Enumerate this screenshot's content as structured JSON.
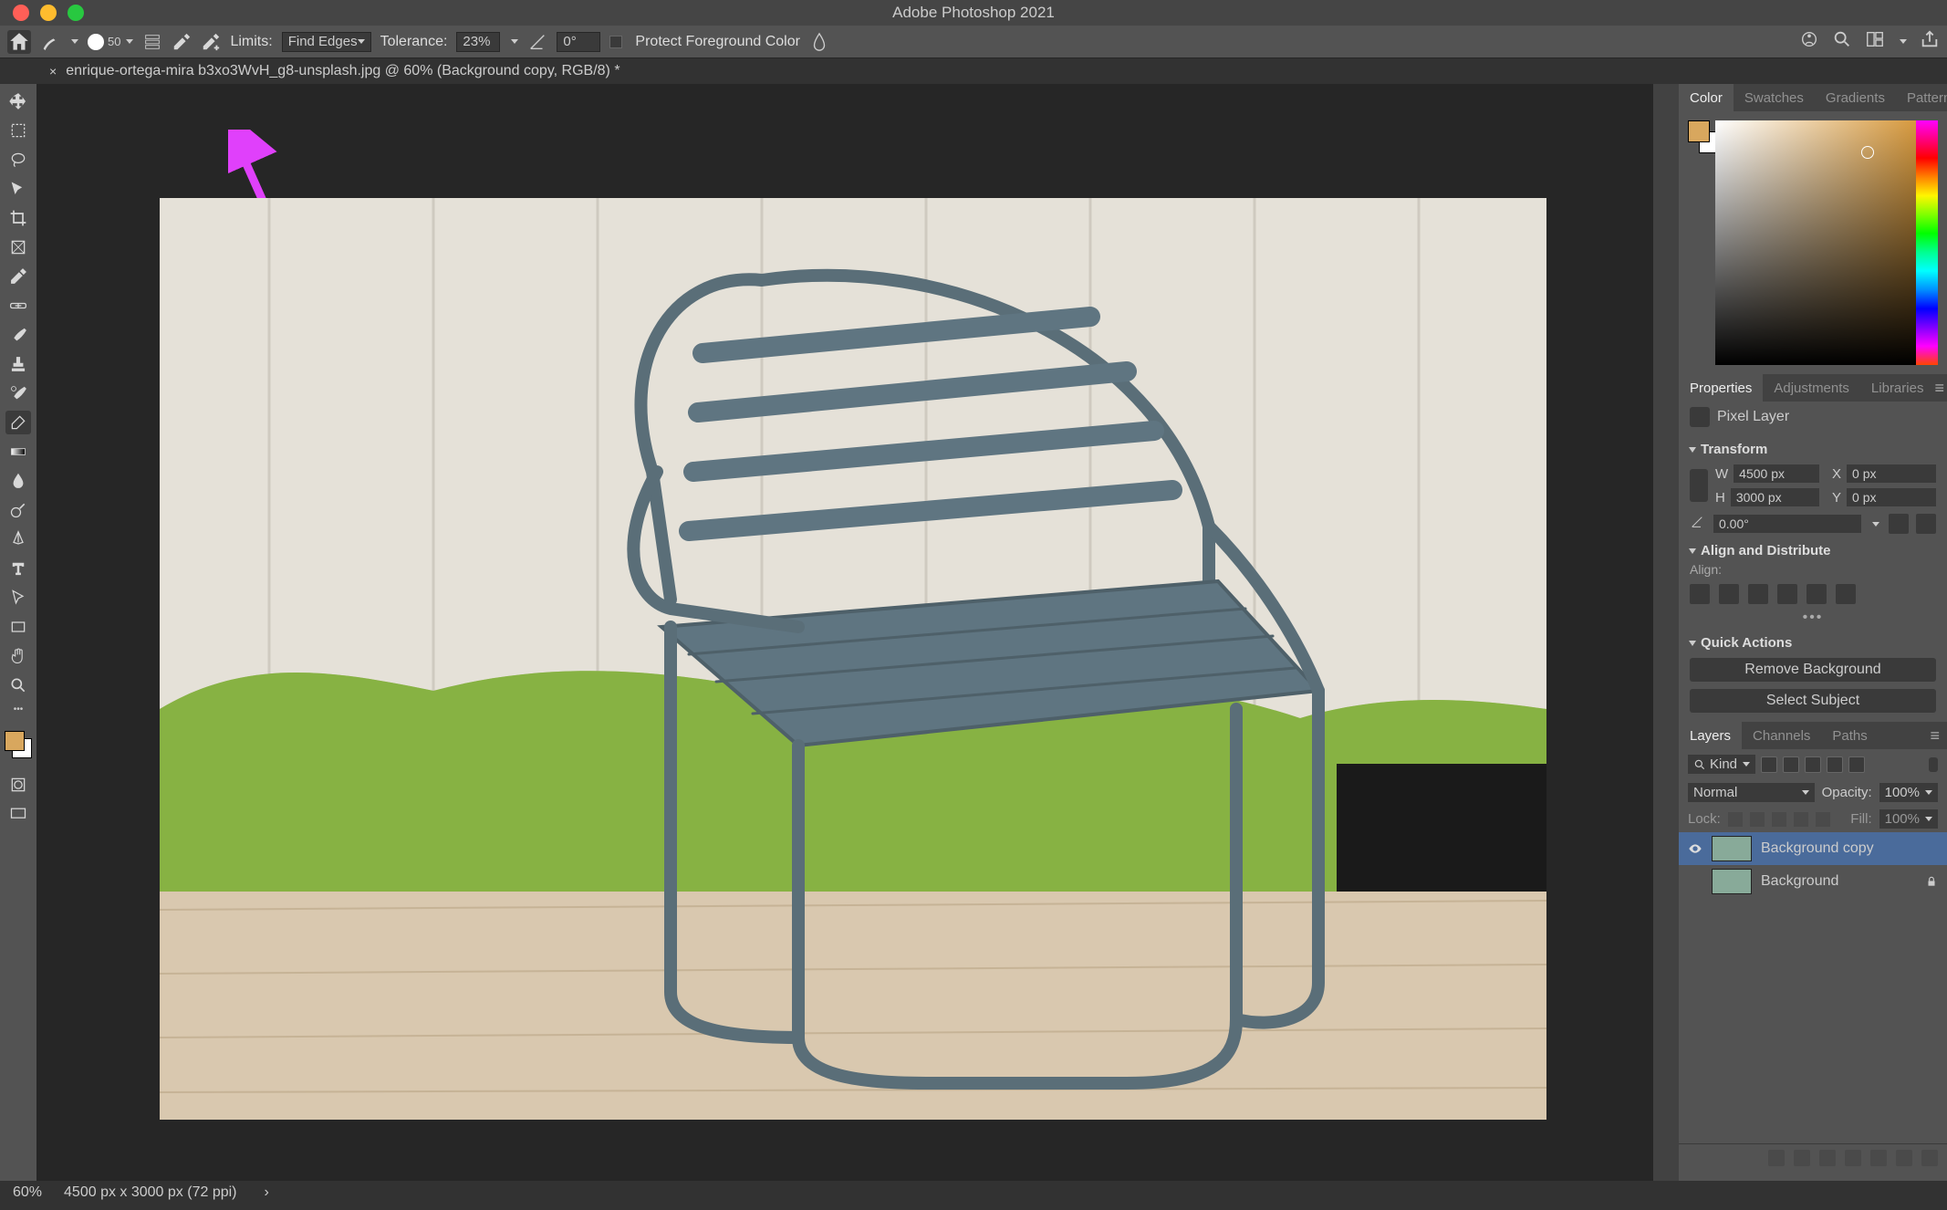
{
  "titlebar": {
    "title": "Adobe Photoshop 2021"
  },
  "optbar": {
    "brush_size": "50",
    "limits_label": "Limits:",
    "limits_value": "Find Edges",
    "tolerance_label": "Tolerance:",
    "tolerance_value": "23%",
    "angle_value": "0°",
    "protect_label": "Protect Foreground Color"
  },
  "doctab": {
    "tabname": "enrique-ortega-mira         b3xo3WvH_g8-unsplash.jpg @ 60% (Background copy, RGB/8) *"
  },
  "color_panel": {
    "tabs": [
      "Color",
      "Swatches",
      "Gradients",
      "Patterns"
    ]
  },
  "prop_panel": {
    "tabs": [
      "Properties",
      "Adjustments",
      "Libraries"
    ],
    "layer_type": "Pixel Layer",
    "sec_transform": "Transform",
    "W": "W",
    "W_val": "4500 px",
    "H": "H",
    "H_val": "3000 px",
    "X": "X",
    "X_val": "0 px",
    "Y": "Y",
    "Y_val": "0 px",
    "angle": "0.00°",
    "sec_align": "Align and Distribute",
    "align_label": "Align:",
    "sec_quick": "Quick Actions",
    "btn_removebg": "Remove Background",
    "btn_selsubj": "Select Subject"
  },
  "layers_panel": {
    "tabs": [
      "Layers",
      "Channels",
      "Paths"
    ],
    "kind": "Kind",
    "blend": "Normal",
    "opacity_label": "Opacity:",
    "opacity_value": "100%",
    "lock_label": "Lock:",
    "fill_label": "Fill:",
    "fill_value": "100%",
    "layers": [
      {
        "name": "Background copy"
      },
      {
        "name": "Background"
      }
    ]
  },
  "status": {
    "zoom": "60%",
    "docinfo": "4500 px x 3000 px (72 ppi)"
  },
  "colors": {
    "fg": "#d8a75e",
    "bg": "#ffffff"
  }
}
